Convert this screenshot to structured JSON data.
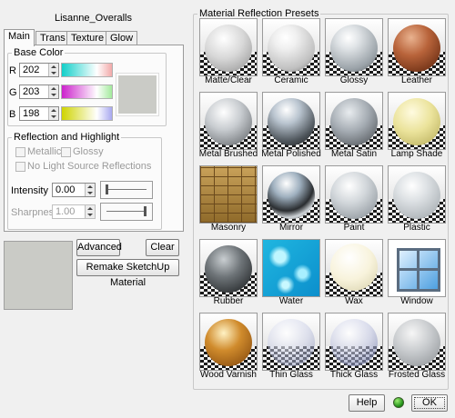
{
  "material_name": "Lisanne_Overalls",
  "tabs": [
    "Main",
    "Trans",
    "Texture",
    "Glow"
  ],
  "base_color": {
    "legend": "Base Color",
    "r_label": "R",
    "r_value": "202",
    "g_label": "G",
    "g_value": "203",
    "b_label": "B",
    "b_value": "198",
    "color": "#cacbc6"
  },
  "reflection": {
    "legend": "Reflection and Highlight",
    "metallic": "Metallic",
    "glossy": "Glossy",
    "no_light": "No Light Source Reflections",
    "intensity_label": "Intensity",
    "intensity_value": "0.00",
    "sharpness_label": "Sharpness",
    "sharpness_value": "1.00"
  },
  "buttons": {
    "advanced": "Advanced",
    "clear": "Clear",
    "remake": "Remake SketchUp Material",
    "help": "Help",
    "ok": "OK"
  },
  "presets_title": "Material Reflection Presets",
  "presets": [
    {
      "label": "Matte/Clear"
    },
    {
      "label": "Ceramic"
    },
    {
      "label": "Glossy"
    },
    {
      "label": "Leather"
    },
    {
      "label": "Metal Brushed"
    },
    {
      "label": "Metal Polished"
    },
    {
      "label": "Metal Satin"
    },
    {
      "label": "Lamp Shade"
    },
    {
      "label": "Masonry"
    },
    {
      "label": "Mirror"
    },
    {
      "label": "Paint"
    },
    {
      "label": "Plastic"
    },
    {
      "label": "Rubber"
    },
    {
      "label": "Water"
    },
    {
      "label": "Wax"
    },
    {
      "label": "Window"
    },
    {
      "label": "Wood Varnish"
    },
    {
      "label": "Thin Glass"
    },
    {
      "label": "Thick Glass"
    },
    {
      "label": "Frosted Glass"
    }
  ],
  "status_color": "#2aa51c"
}
